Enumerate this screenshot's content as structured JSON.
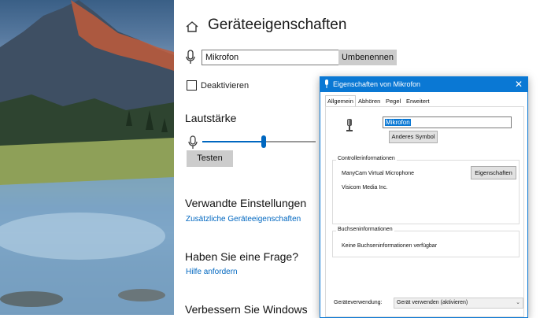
{
  "settings": {
    "title": "Geräteeigenschaften",
    "device_name": "Mikrofon",
    "rename_label": "Umbenennen",
    "disable_label": "Deaktivieren",
    "volume_heading": "Lautstärke",
    "volume_level": 0.54,
    "test_label": "Testen",
    "related_heading": "Verwandte Einstellungen",
    "related_link": "Zusätzliche Geräteeigenschaften",
    "question_heading": "Haben Sie eine Frage?",
    "help_link": "Hilfe anfordern",
    "improve_heading": "Verbessern Sie Windows"
  },
  "dialog": {
    "title": "Eigenschaften von Mikrofon",
    "close_glyph": "✕",
    "tabs": [
      "Allgemein",
      "Abhören",
      "Pegel",
      "Erweitert"
    ],
    "active_tab": "Allgemein",
    "name_value": "Mikrofon",
    "change_icon_label": "Anderes Symbol",
    "controller_group": "Controllerinformationen",
    "controller_name": "ManyCam Virtual Microphone",
    "controller_vendor": "Visicom Media Inc.",
    "properties_label": "Eigenschaften",
    "jack_group": "Buchseninformationen",
    "jack_text": "Keine Buchseninformationen verfügbar",
    "usage_label": "Geräteverwendung:",
    "usage_value": "Gerät verwenden (aktivieren)"
  },
  "colors": {
    "accent": "#0067c0",
    "titlebar": "#0a78d4",
    "button_gray": "#cccccc"
  },
  "icons": [
    "home-icon",
    "microphone-icon",
    "close-icon",
    "chevron-down-icon"
  ]
}
